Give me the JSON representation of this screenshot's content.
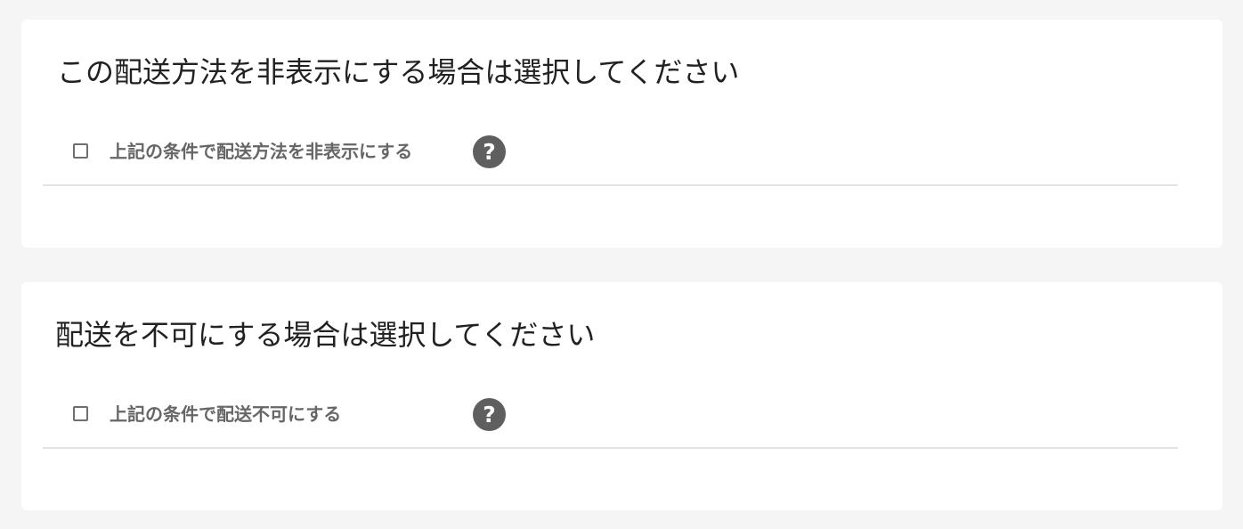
{
  "sections": [
    {
      "title": "この配送方法を非表示にする場合は選択してください",
      "option_label": "上記の条件で配送方法を非表示にする",
      "checked": false,
      "help_glyph": "?"
    },
    {
      "title": "配送を不可にする場合は選択してください",
      "option_label": "上記の条件で配送不可にする",
      "checked": false,
      "help_glyph": "?"
    }
  ],
  "colors": {
    "page_background": "#f5f5f5",
    "card_background": "#ffffff",
    "title_text": "#212121",
    "label_text": "#666666",
    "help_icon": "#5f5f5f",
    "divider": "#e3e3e3"
  },
  "icons": {
    "checkbox": "checkbox-unchecked-icon",
    "help": "question-circle-icon"
  }
}
